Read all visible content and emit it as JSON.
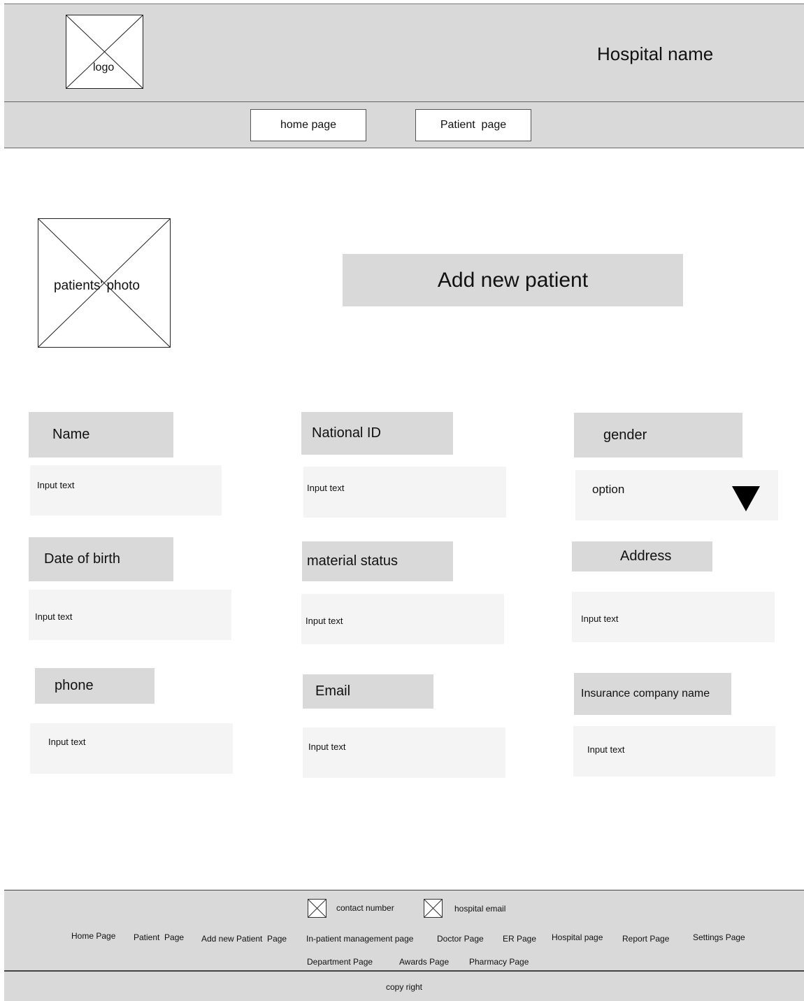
{
  "header": {
    "logo_label": "logo",
    "hospital_name": "Hospital name"
  },
  "nav": {
    "items": [
      {
        "label": "home page"
      },
      {
        "label": "Patient  page"
      }
    ]
  },
  "main": {
    "photo_label": "patients' photo",
    "page_title": "Add new patient",
    "fields": {
      "name": {
        "label": "Name",
        "placeholder": "Input text"
      },
      "national_id": {
        "label": "National ID",
        "placeholder": "Input text"
      },
      "gender": {
        "label": "gender",
        "selected": "option"
      },
      "dob": {
        "label": "Date of birth",
        "placeholder": "Input text"
      },
      "marital": {
        "label": "material status",
        "placeholder": "Input text"
      },
      "address": {
        "label": "Address",
        "placeholder": "Input text"
      },
      "phone": {
        "label": "phone",
        "placeholder": "Input text"
      },
      "email": {
        "label": "Email",
        "placeholder": "Input text"
      },
      "insurance": {
        "label": "Insurance company name",
        "placeholder": "Input text"
      }
    }
  },
  "footer": {
    "contact_number": "contact number",
    "hospital_email": "hospital email",
    "links": [
      {
        "label": "Home Page"
      },
      {
        "label": "Patient  Page"
      },
      {
        "label": "Add new Patient  Page"
      },
      {
        "label": "In-patient management page"
      },
      {
        "label": "Doctor Page"
      },
      {
        "label": "ER Page"
      },
      {
        "label": "Hospital page"
      },
      {
        "label": "Report Page"
      },
      {
        "label": "Settings Page"
      },
      {
        "label": "Department Page"
      },
      {
        "label": "Awards Page"
      },
      {
        "label": "Pharmacy Page"
      }
    ],
    "copyright": "copy right"
  }
}
